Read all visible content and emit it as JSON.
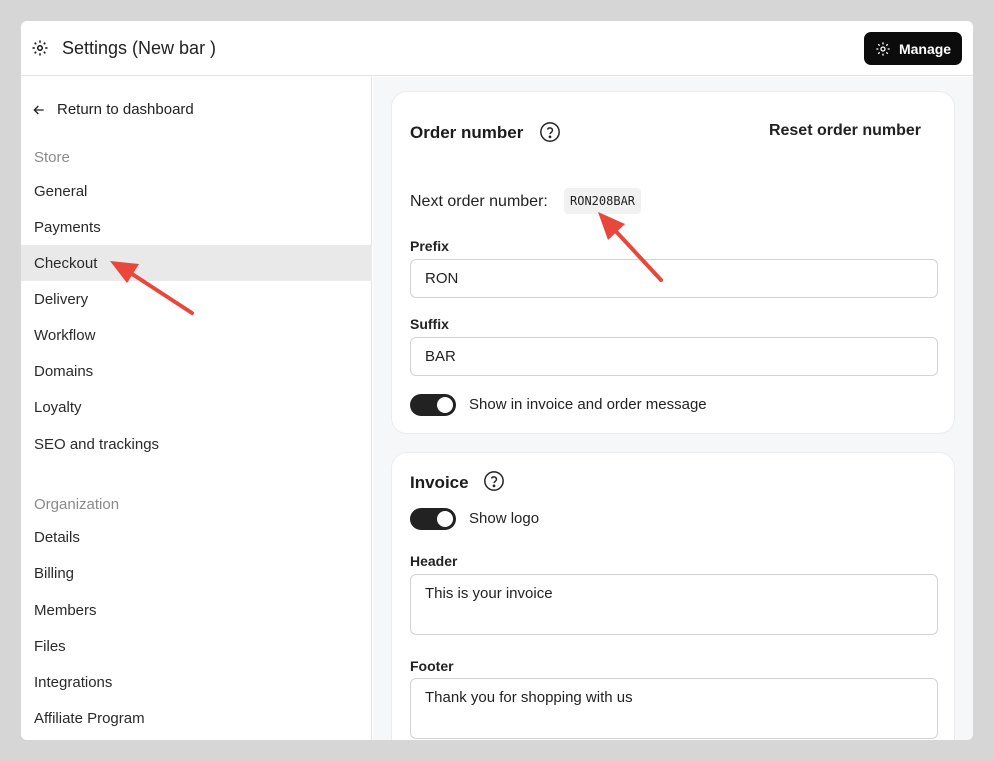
{
  "header": {
    "title": "Settings (New bar )",
    "manage_label": "Manage"
  },
  "sidebar": {
    "back_label": "Return to dashboard",
    "store_heading": "Store",
    "store_items": [
      "General",
      "Payments",
      "Checkout",
      "Delivery",
      "Workflow",
      "Domains",
      "Loyalty",
      "SEO and trackings"
    ],
    "org_heading": "Organization",
    "org_items": [
      "Details",
      "Billing",
      "Members",
      "Files",
      "Integrations",
      "Affiliate Program"
    ],
    "active_item": "Checkout"
  },
  "order_card": {
    "title": "Order number",
    "reset_label": "Reset order number",
    "next_label": "Next order number:",
    "next_value": "RON208BAR",
    "prefix_label": "Prefix",
    "prefix_value": "RON",
    "suffix_label": "Suffix",
    "suffix_value": "BAR",
    "toggle_label": "Show in invoice and order message",
    "toggle_on": true
  },
  "invoice_card": {
    "title": "Invoice",
    "logo_toggle_label": "Show logo",
    "logo_toggle_on": true,
    "header_label": "Header",
    "header_value": "This is your invoice",
    "footer_label": "Footer",
    "footer_value": "Thank you for shopping with us"
  },
  "colors": {
    "annotation_arrow": "#e8473b",
    "active_nav_bg": "#e9e9e9",
    "toggle_on": "#222222"
  }
}
